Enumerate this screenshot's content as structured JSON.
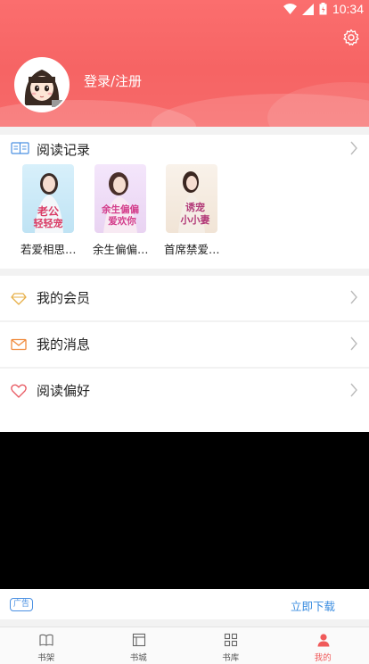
{
  "status_bar": {
    "time": "10:34"
  },
  "header": {
    "login_label": "登录/注册"
  },
  "reading_record": {
    "title": "阅读记录",
    "books": [
      {
        "title": "若爱相思…",
        "cover_text": "老公轻轻宠"
      },
      {
        "title": "余生偏偏…",
        "cover_text": "余生偏偏爱欢你"
      },
      {
        "title": "首席禁爱…",
        "cover_text": "诱宠小小妻"
      }
    ]
  },
  "menu": [
    {
      "label": "我的会员",
      "icon": "diamond-icon",
      "color": "#e7b04a"
    },
    {
      "label": "我的消息",
      "icon": "mail-icon",
      "color": "#f08a3c"
    },
    {
      "label": "阅读偏好",
      "icon": "heart-icon",
      "color": "#e85a63"
    }
  ],
  "ad": {
    "tag": "广告",
    "download": "立即下载"
  },
  "tabs": [
    {
      "label": "书架",
      "icon": "book-open-icon",
      "active": false
    },
    {
      "label": "书城",
      "icon": "store-icon",
      "active": false
    },
    {
      "label": "书库",
      "icon": "grid-icon",
      "active": false
    },
    {
      "label": "我的",
      "icon": "person-icon",
      "active": true
    }
  ],
  "colors": {
    "header": "#f66464",
    "accent": "#f05a5a",
    "link": "#3b8de0"
  }
}
